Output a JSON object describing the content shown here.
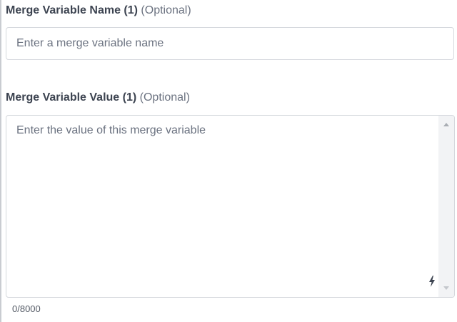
{
  "merge_name": {
    "label": "Merge Variable Name (1)",
    "optional": "(Optional)",
    "placeholder": "Enter a merge variable name",
    "value": ""
  },
  "merge_value": {
    "label": "Merge Variable Value (1)",
    "optional": "(Optional)",
    "placeholder": "Enter the value of this merge variable",
    "value": "",
    "counter": "0/8000"
  },
  "icons": {
    "resize": "lightning-bolt-icon",
    "scroll_up": "scroll-up-arrow-icon",
    "scroll_down": "scroll-down-arrow-icon"
  },
  "colors": {
    "text": "#3d4451",
    "muted": "#6b7280",
    "border": "#d5d8dd"
  }
}
